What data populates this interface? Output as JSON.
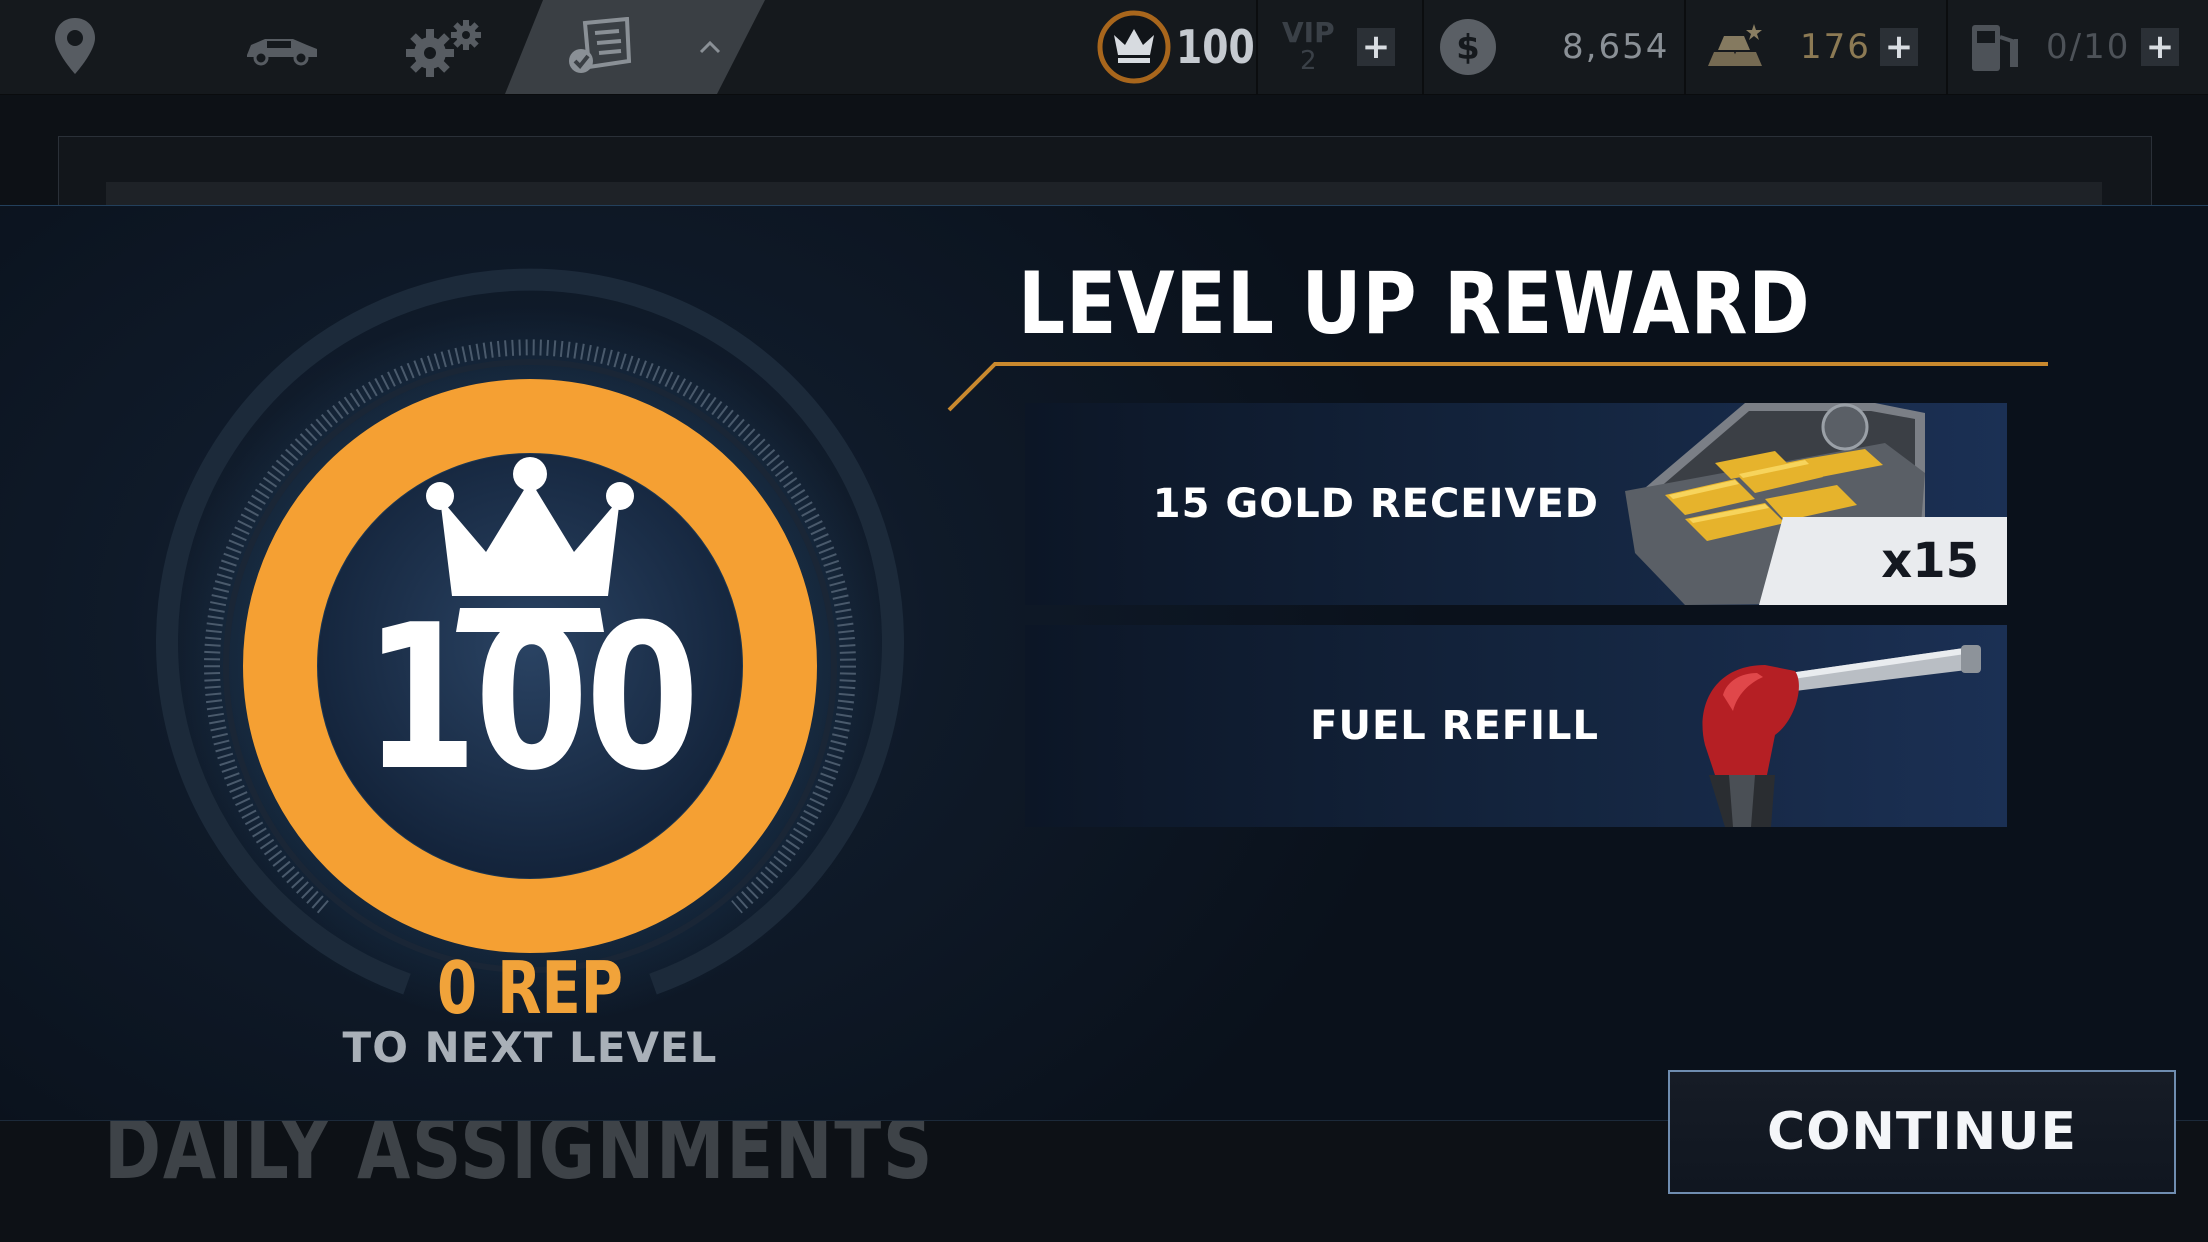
{
  "topbar": {
    "nav": [
      {
        "name": "map-pin-icon"
      },
      {
        "name": "car-icon"
      },
      {
        "name": "gears-icon"
      },
      {
        "name": "assignments-checklist-icon",
        "active": true
      }
    ],
    "level": "100",
    "vip_label": "VIP",
    "vip_level": "2",
    "cash": "8,654",
    "gold": "176",
    "fuel": "0/10"
  },
  "background": {
    "section_title": "DAILY ASSIGNMENTS"
  },
  "modal": {
    "title": "LEVEL UP REWARD",
    "level_number": "100",
    "rep_value": "0 REP",
    "rep_label": "TO NEXT LEVEL",
    "rewards": [
      {
        "label": "15 GOLD RECEIVED",
        "quantity": "x15",
        "icon": "gold-briefcase-icon"
      },
      {
        "label": "FUEL REFILL",
        "icon": "fuel-nozzle-icon"
      }
    ],
    "continue_label": "CONTINUE"
  },
  "colors": {
    "accent_orange": "#f5a033",
    "panel_blue": "#14253f",
    "button_border": "#6f8db0"
  }
}
